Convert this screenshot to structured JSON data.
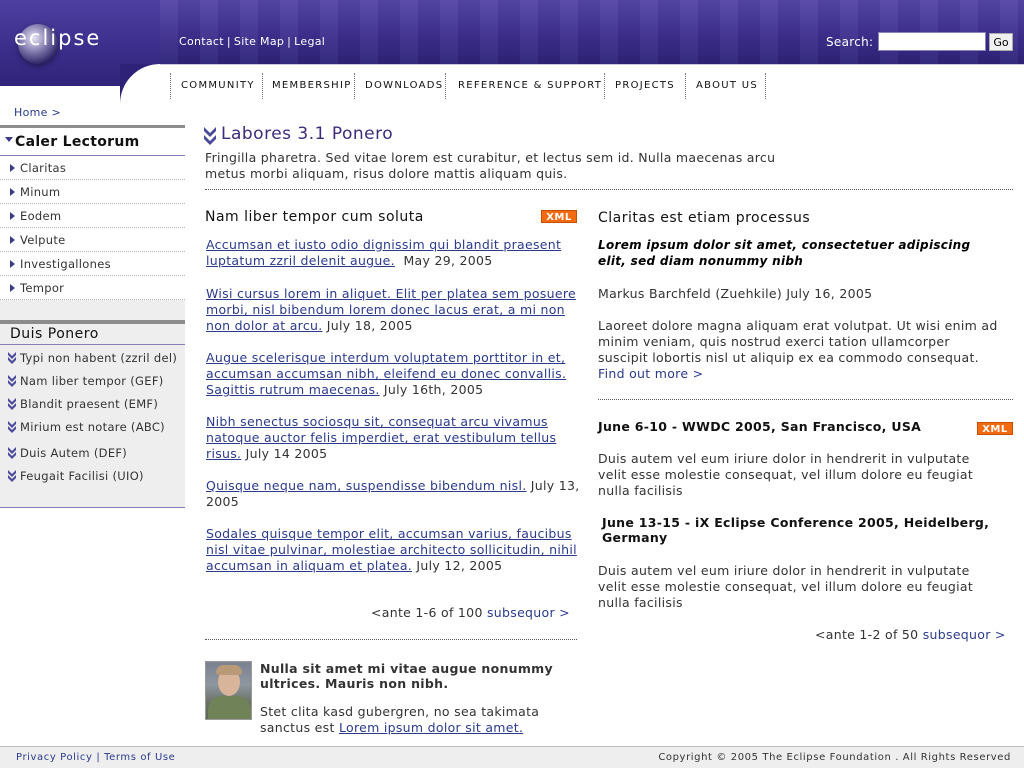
{
  "header": {
    "logo_text": "eclipse",
    "top_links": [
      "Contact",
      "Site Map",
      "Legal"
    ],
    "search_label": "Search:",
    "search_value": "",
    "go_label": "Go",
    "header_color": "#3d2f8e"
  },
  "nav": [
    "COMMUNITY",
    "MEMBERSHIP",
    "DOWNLOADS",
    "REFERENCE & SUPPORT",
    "PROJECTS",
    "ABOUT US"
  ],
  "breadcrumb": "Home >",
  "sidebar": {
    "section1_title": "Caler Lectorum",
    "section1_items": [
      "Claritas",
      "Minum",
      "Eodem",
      "Velpute",
      "Investigallones",
      "Tempor"
    ],
    "section2_title": "Duis Ponero",
    "section2_items": [
      "Typi non habent (zzril del)",
      "Nam liber tempor (GEF)",
      "Blandit praesent (EMF)",
      "Mirium est notare (ABC)",
      "Duis Autem (DEF)",
      "Feugait Facilisi (UIO)"
    ]
  },
  "main": {
    "title": "Labores 3.1 Ponero",
    "description": "Fringilla pharetra. Sed vitae lorem est curabitur, et lectus sem id. Nulla maecenas arcu metus morbi aliquam, risus dolore mattis aliquam quis."
  },
  "left_col": {
    "title": "Nam liber tempor cum soluta",
    "xml_label": "XML",
    "items": [
      {
        "link": "Accumsan et iusto odio dignissim qui blandit praesent luptatum zzril delenit augue.",
        "date": "May 29, 2005"
      },
      {
        "link": "Wisi cursus lorem in aliquet. Elit per platea sem posuere morbi, nisl bibendum lorem donec lacus erat, a mi non non dolor at arcu.",
        "date": "July 18, 2005"
      },
      {
        "link": "Augue scelerisque interdum voluptatem porttitor in et, accumsan accumsan nibh, eleifend eu donec convallis. Sagittis rutrum maecenas.",
        "date": "July 16th, 2005"
      },
      {
        "link": "Nibh senectus sociosqu sit, consequat arcu vivamus natoque auctor felis imperdiet, erat vestibulum tellus risus.",
        "date": "July 14 2005"
      },
      {
        "link": "Quisque neque nam, suspendisse bibendum nisl.",
        "date": "July 13, 2005"
      },
      {
        "link": "Sodales quisque tempor elit, accumsan varius, faucibus nisl vitae pulvinar, molestiae architecto sollicitudin, nihil accumsan in aliquam et platea.",
        "date": "July 12, 2005"
      }
    ],
    "pager_prev": "<ante 1-6 of 100",
    "pager_next": "subsequor >",
    "profile_heading": "Nulla sit amet mi vitae augue nonummy ultrices. Mauris non nibh.",
    "profile_text": "Stet clita kasd gubergren, no sea takimata sanctus est",
    "profile_link": "Lorem ipsum dolor sit amet."
  },
  "right_col": {
    "title": "Claritas est etiam processus",
    "lead": "Lorem ipsum dolor sit amet, consectetuer adipiscing elit, sed diam nonummy nibh",
    "byline": "Markus Barchfeld (Zuehkile) July 16, 2005",
    "body": "Laoreet dolore magna aliquam erat volutpat. Ut wisi enim ad minim veniam, quis nostrud exerci tation ullamcorper suscipit lobortis nisl ut aliquip ex ea commodo consequat.",
    "find_out": "Find out more >",
    "events": [
      {
        "title": "June 6-10 - WWDC 2005, San Francisco, USA",
        "text": "Duis autem vel eum iriure dolor in hendrerit in vulputate velit esse molestie consequat, vel illum dolore eu feugiat nulla facilisis"
      },
      {
        "title": "June 13-15 - iX Eclipse Conference 2005, Heidelberg, Germany",
        "text": "Duis autem vel eum iriure dolor in hendrerit in vulputate velit esse molestie consequat, vel illum dolore eu feugiat nulla facilisis"
      }
    ],
    "xml_label": "XML",
    "pager_prev": "<ante 1-2 of 50",
    "pager_next": "subsequor >"
  },
  "footer": {
    "privacy": "Privacy Policy",
    "terms": "Terms of Use",
    "copyright": "Copyright © 2005  The Eclipse Foundation . All Rights Reserved"
  }
}
